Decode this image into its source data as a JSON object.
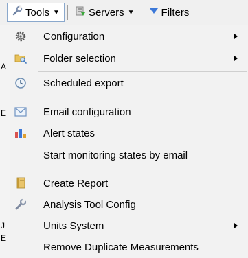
{
  "toolbar": {
    "tools_label": "Tools",
    "servers_label": "Servers",
    "filters_label": "Filters"
  },
  "menu": {
    "items": [
      {
        "label": "Configuration",
        "icon": "gear-icon",
        "submenu": true
      },
      {
        "label": "Folder selection",
        "icon": "folder-search-icon",
        "submenu": true
      },
      {
        "label": "Scheduled export",
        "icon": "clock-icon",
        "submenu": false
      },
      {
        "label": "Email configuration",
        "icon": "envelope-icon",
        "submenu": false
      },
      {
        "label": "Alert states",
        "icon": "bar-chart-icon",
        "submenu": false
      },
      {
        "label": "Start monitoring states by email",
        "icon": "",
        "submenu": false
      },
      {
        "label": "Create Report",
        "icon": "report-book-icon",
        "submenu": false
      },
      {
        "label": "Analysis Tool Config",
        "icon": "wrench-icon",
        "submenu": false
      },
      {
        "label": "Units System",
        "icon": "",
        "submenu": true
      },
      {
        "label": "Remove Duplicate Measurements",
        "icon": "",
        "submenu": false
      }
    ]
  },
  "colors": {
    "menu_background": "#f2f2f2",
    "toolbar_background": "#f0f0f0",
    "active_border": "#8aa8cc",
    "filter_icon": "#3c78d8"
  }
}
